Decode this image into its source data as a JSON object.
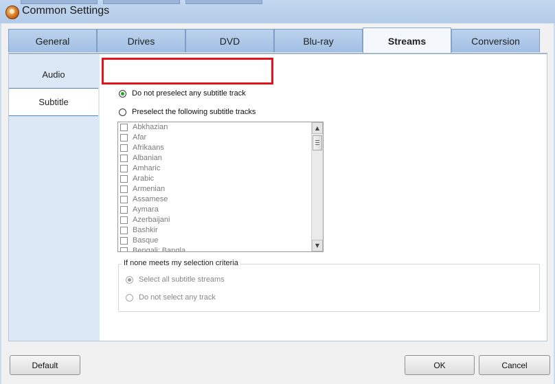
{
  "window": {
    "title": "Common Settings",
    "app_icon": "app-logo-icon"
  },
  "tabs": [
    {
      "label": "General",
      "active": false
    },
    {
      "label": "Drives",
      "active": false
    },
    {
      "label": "DVD",
      "active": false
    },
    {
      "label": "Blu-ray",
      "active": false
    },
    {
      "label": "Streams",
      "active": true
    },
    {
      "label": "Conversion",
      "active": false
    }
  ],
  "sidebar": {
    "items": [
      {
        "label": "Audio",
        "active": false
      },
      {
        "label": "Subtitle",
        "active": true
      }
    ]
  },
  "subtitle": {
    "option_none": "Do not preselect any subtitle track",
    "option_preselect": "Preselect the following subtitle tracks",
    "selected_option": "none",
    "languages": [
      "Abkhazian",
      "Afar",
      "Afrikaans",
      "Albanian",
      "Amharic",
      "Arabic",
      "Armenian",
      "Assamese",
      "Aymara",
      "Azerbaijani",
      "Bashkir",
      "Basque",
      "Bengali; Bangla"
    ],
    "fallback": {
      "legend": "If none meets my selection criteria",
      "option_all": "Select all subtitle streams",
      "option_no_track": "Do not select any track",
      "selected_option": "all"
    }
  },
  "buttons": {
    "default": "Default",
    "ok": "OK",
    "cancel": "Cancel"
  },
  "colors": {
    "highlight": "#e3141b",
    "radio_selected": "#1ea51e",
    "sidebar_bg": "#dce8f6",
    "tab_bg": "#a2bfe3"
  }
}
